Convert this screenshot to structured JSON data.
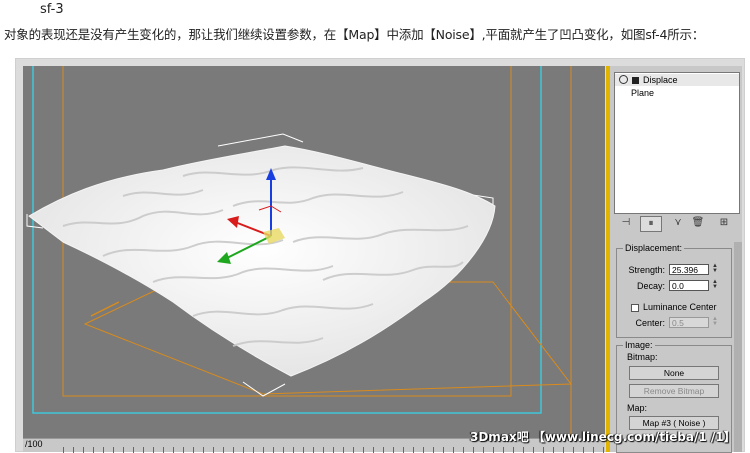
{
  "caption": {
    "title": "sf-3",
    "description": "对象的表现还是没有产生变化的，那让我们继续设置参数，在【Map】中添加【Noise】,平面就产生了凹凸变化，如图sf-4所示："
  },
  "timeline": {
    "frame_label": "/100"
  },
  "modifier_stack": {
    "items": [
      {
        "label": "Displace"
      },
      {
        "label": "Plane"
      }
    ]
  },
  "displacement": {
    "title": "Displacement:",
    "strength_label": "Strength:",
    "strength_value": "25.396",
    "decay_label": "Decay:",
    "decay_value": "0.0",
    "luminance_label": "Luminance Center",
    "center_label": "Center:",
    "center_value": "0.5"
  },
  "image": {
    "title": "Image:",
    "bitmap_label": "Bitmap:",
    "bitmap_button": "None",
    "remove_bitmap_button": "Remove Bitmap",
    "map_label": "Map:",
    "map_button": "Map #3  ( Noise )"
  },
  "watermark": "3Dmax吧 【www.linecg.com/tieba/1 /1】",
  "colors": {
    "viewport_bg": "#7a7a7a",
    "panel_bg": "#c8c8c8",
    "separator": "#e0b400",
    "safe_frame": "#3fc6d9",
    "gizmo_orange": "#d98b1c"
  }
}
